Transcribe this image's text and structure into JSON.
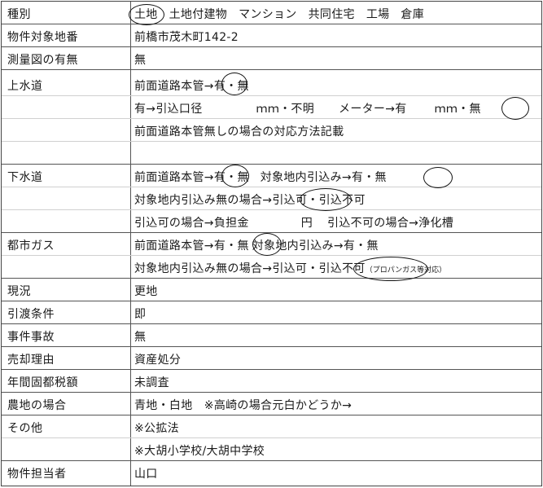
{
  "rows": {
    "kind": {
      "label": "種別",
      "options": [
        "土地",
        "土地付建物",
        "マンション",
        "共同住宅",
        "工場",
        "倉庫"
      ]
    },
    "address": {
      "label": "物件対象地番",
      "value": "前橋市茂木町142-2"
    },
    "survey": {
      "label": "測量図の有無",
      "value": "無"
    },
    "water": {
      "label": "上水道",
      "line1": {
        "prefix": "前面道路本管→",
        "yes": "有",
        "dot": "・",
        "no": "無"
      },
      "line2": {
        "text1": "有→引込口径",
        "unit": "ｍｍ・不明",
        "meter": "メーター→有",
        "unit2": "ｍｍ・",
        "no": "無"
      },
      "line3": "前面道路本管無しの場合の対応方法記載"
    },
    "sewer": {
      "label": "下水道",
      "line1": {
        "prefix": "前面道路本管→",
        "yes": "有",
        "dot": "・",
        "no": "無",
        "intake": "対象地内引込み→有・",
        "intake_no": "無"
      },
      "line2": {
        "prefix": "対象地内引込み無の場合→",
        "ok": "引込可",
        "dot": "・",
        "ng": "引込不可"
      },
      "line3": {
        "text1": "引込可の場合→負担金",
        "yen": "円",
        "text2": "引込不可の場合→浄化槽"
      }
    },
    "gas": {
      "label": "都市ガス",
      "line1": {
        "prefix": "前面道路本管→有・",
        "no": "無",
        "intake": "対象地内引込み→有・無"
      },
      "line2": {
        "prefix": "対象地内引込み無の場合→引込可・",
        "ng": "引込不可",
        "note": "（プロパンガス等対応）"
      }
    },
    "status": {
      "label": "現況",
      "value": "更地"
    },
    "handover": {
      "label": "引渡条件",
      "value": "即"
    },
    "incident": {
      "label": "事件事故",
      "value": "無"
    },
    "reason": {
      "label": "売却理由",
      "value": "資産処分"
    },
    "tax": {
      "label": "年間固都税額",
      "value": "未調査"
    },
    "farmland": {
      "label": "農地の場合",
      "value": "青地・白地　※高崎の場合元白かどうか→"
    },
    "other": {
      "label": "その他",
      "line1": "※公拡法",
      "line2": "※大胡小学校/大胡中学校"
    },
    "staff": {
      "label": "物件担当者",
      "value": "山口"
    }
  }
}
